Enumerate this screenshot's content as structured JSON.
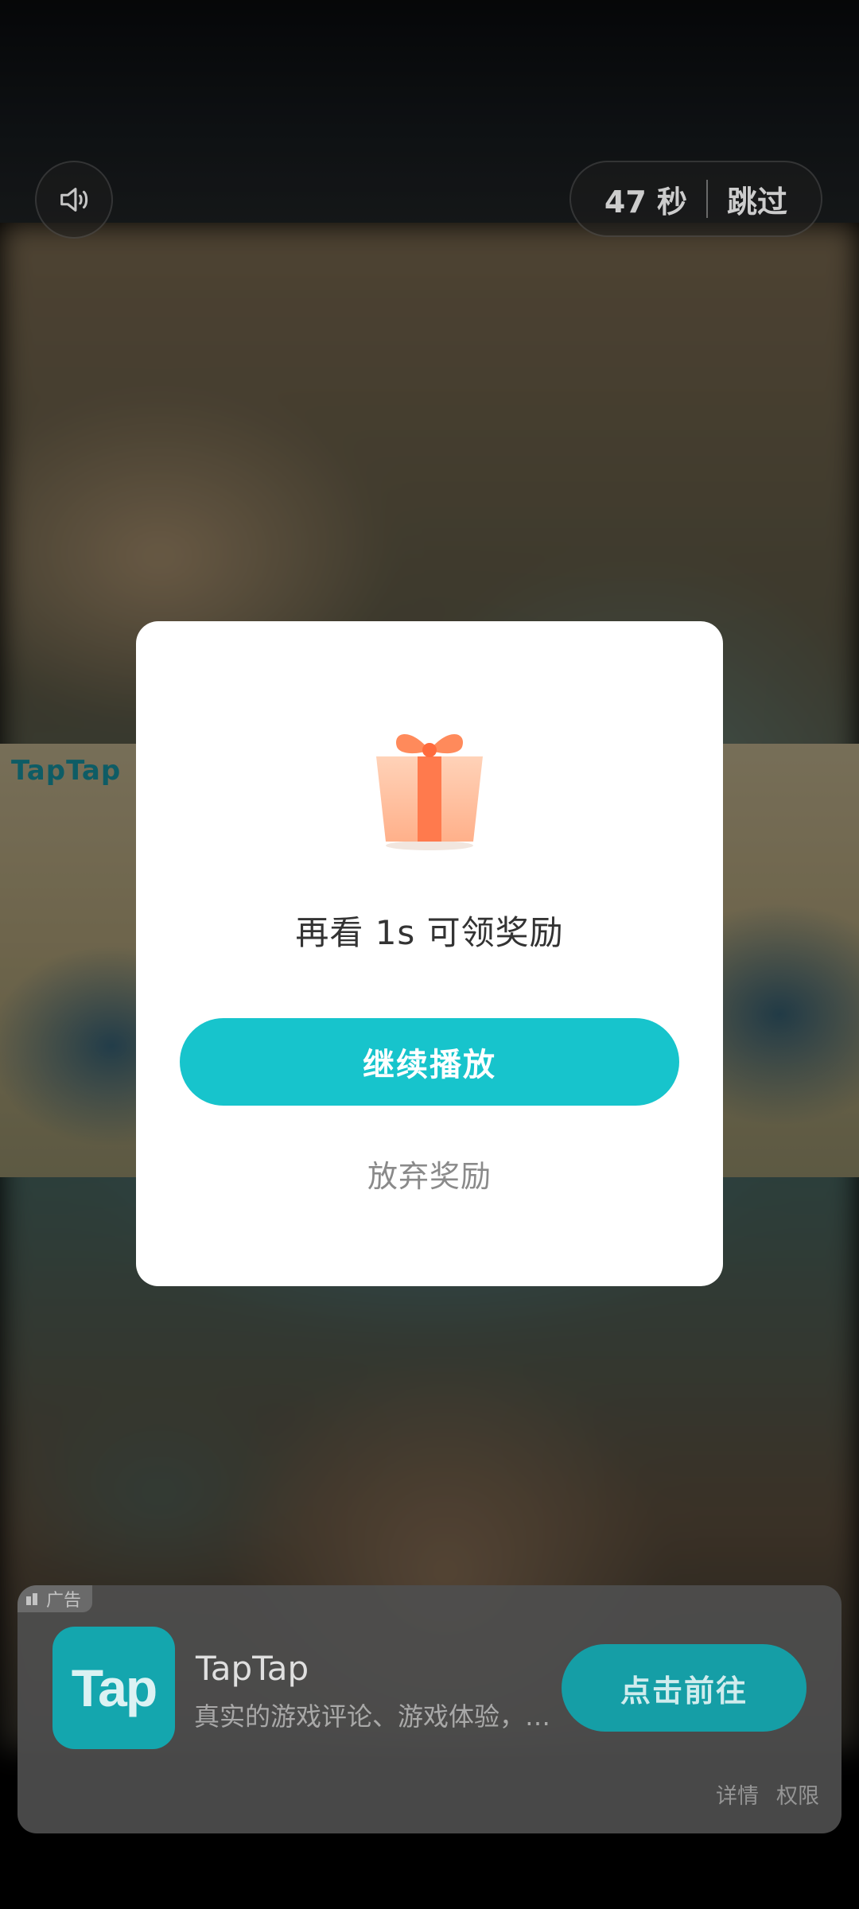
{
  "top": {
    "timer_seconds": "47 秒",
    "skip_label": "跳过",
    "sound_icon": "speaker-icon"
  },
  "game": {
    "title": "TapTap"
  },
  "dialog": {
    "message": "再看 1s 可领奖励",
    "continue_label": "继续播放",
    "abandon_label": "放弃奖励",
    "gift_icon": "gift-icon",
    "accent_color": "#17c4cc"
  },
  "ad": {
    "badge_label": "广告",
    "app_name": "TapTap",
    "app_icon_text": "Tap",
    "description": "真实的游戏评论、游戏体验，…",
    "cta_label": "点击前往",
    "details_label": "详情",
    "permissions_label": "权限"
  }
}
